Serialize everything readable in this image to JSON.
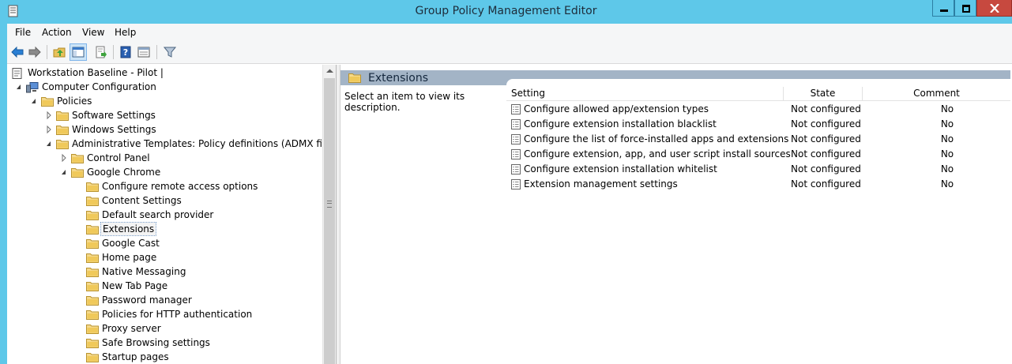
{
  "window": {
    "title": "Group Policy Management Editor"
  },
  "menu": [
    "File",
    "Action",
    "View",
    "Help"
  ],
  "toolbar": {
    "icons": [
      "back-arrow-icon",
      "forward-arrow-icon",
      "up-folder-icon",
      "show-hide-tree-icon",
      "export-list-icon",
      "help-icon",
      "properties-icon",
      "filter-icon"
    ]
  },
  "tree": {
    "items": [
      {
        "label": "Workstation Baseline - Pilot |",
        "level": 0,
        "icon": "policy-doc-icon",
        "expander": ""
      },
      {
        "label": "Computer Configuration",
        "level": 1,
        "icon": "computer-icon",
        "expander": "expanded"
      },
      {
        "label": "Policies",
        "level": 2,
        "icon": "folder-icon",
        "expander": "expanded"
      },
      {
        "label": "Software Settings",
        "level": 3,
        "icon": "folder-icon",
        "expander": "collapsed"
      },
      {
        "label": "Windows Settings",
        "level": 3,
        "icon": "folder-icon",
        "expander": "collapsed"
      },
      {
        "label": "Administrative Templates: Policy definitions (ADMX files) re",
        "level": 3,
        "icon": "folder-icon",
        "expander": "expanded"
      },
      {
        "label": "Control Panel",
        "level": 4,
        "icon": "folder-icon",
        "expander": "collapsed"
      },
      {
        "label": "Google Chrome",
        "level": 4,
        "icon": "folder-icon",
        "expander": "expanded"
      },
      {
        "label": "Configure remote access options",
        "level": 5,
        "icon": "folder-icon",
        "expander": ""
      },
      {
        "label": "Content Settings",
        "level": 5,
        "icon": "folder-icon",
        "expander": ""
      },
      {
        "label": "Default search provider",
        "level": 5,
        "icon": "folder-icon",
        "expander": ""
      },
      {
        "label": "Extensions",
        "level": 5,
        "icon": "folder-icon",
        "expander": "",
        "selected": true
      },
      {
        "label": "Google Cast",
        "level": 5,
        "icon": "folder-icon",
        "expander": ""
      },
      {
        "label": "Home page",
        "level": 5,
        "icon": "folder-icon",
        "expander": ""
      },
      {
        "label": "Native Messaging",
        "level": 5,
        "icon": "folder-icon",
        "expander": ""
      },
      {
        "label": "New Tab Page",
        "level": 5,
        "icon": "folder-icon",
        "expander": ""
      },
      {
        "label": "Password manager",
        "level": 5,
        "icon": "folder-icon",
        "expander": ""
      },
      {
        "label": "Policies for HTTP authentication",
        "level": 5,
        "icon": "folder-icon",
        "expander": ""
      },
      {
        "label": "Proxy server",
        "level": 5,
        "icon": "folder-icon",
        "expander": ""
      },
      {
        "label": "Safe Browsing settings",
        "level": 5,
        "icon": "folder-icon",
        "expander": ""
      },
      {
        "label": "Startup pages",
        "level": 5,
        "icon": "folder-icon",
        "expander": ""
      }
    ]
  },
  "details": {
    "section_title": "Extensions",
    "description": "Select an item to view its description.",
    "columns": {
      "setting": "Setting",
      "state": "State",
      "comment": "Comment"
    },
    "rows": [
      {
        "setting": "Configure allowed app/extension types",
        "state": "Not configured",
        "comment": "No"
      },
      {
        "setting": "Configure extension installation blacklist",
        "state": "Not configured",
        "comment": "No"
      },
      {
        "setting": "Configure the list of force-installed apps and extensions",
        "state": "Not configured",
        "comment": "No"
      },
      {
        "setting": "Configure extension, app, and user script install sources",
        "state": "Not configured",
        "comment": "No"
      },
      {
        "setting": "Configure extension installation whitelist",
        "state": "Not configured",
        "comment": "No"
      },
      {
        "setting": "Extension management settings",
        "state": "Not configured",
        "comment": "No"
      }
    ]
  },
  "colors": {
    "titlebar": "#5ec8e9",
    "close_button": "#c7493f",
    "section_band": "#a3b4c6",
    "folder": "#e8c15a"
  }
}
